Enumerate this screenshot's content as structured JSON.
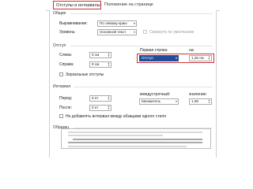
{
  "tabs": [
    {
      "label": "Отступы и интервалы",
      "active": true
    },
    {
      "label": "Положение на странице",
      "active": false
    }
  ],
  "general": {
    "section_label": "Общие",
    "alignment_label": "Выравнивание:",
    "alignment_value": "По левому краю",
    "level_label": "Уровень:",
    "level_value": "Основной текст",
    "collapsed_label": "Свернуто по умолчанию"
  },
  "indent": {
    "section_label": "Отступ",
    "left_label": "Слева:",
    "left_value": "0 см",
    "right_label": "Справа:",
    "right_value": "0 см",
    "first_line_label": "Первая строка:",
    "first_line_value": "Отступ",
    "by_label": "на:",
    "by_value": "1,25 см",
    "mirror_label": "Зеркальные отступы"
  },
  "spacing": {
    "section_label": "Интервал",
    "before_label": "Перед:",
    "before_value": "0 пт",
    "after_label": "После:",
    "after_value": "0 пт",
    "line_spacing_label": "междустрочный:",
    "line_spacing_value": "Множитель",
    "at_label": "значение:",
    "at_value": "1,06",
    "dont_add_label": "Не добавлять интервал между абзацами одного стиля"
  },
  "preview": {
    "section_label": "Образец"
  },
  "colors": {
    "highlight": "#c8323a",
    "selected_fill": "#1f4e9e"
  }
}
